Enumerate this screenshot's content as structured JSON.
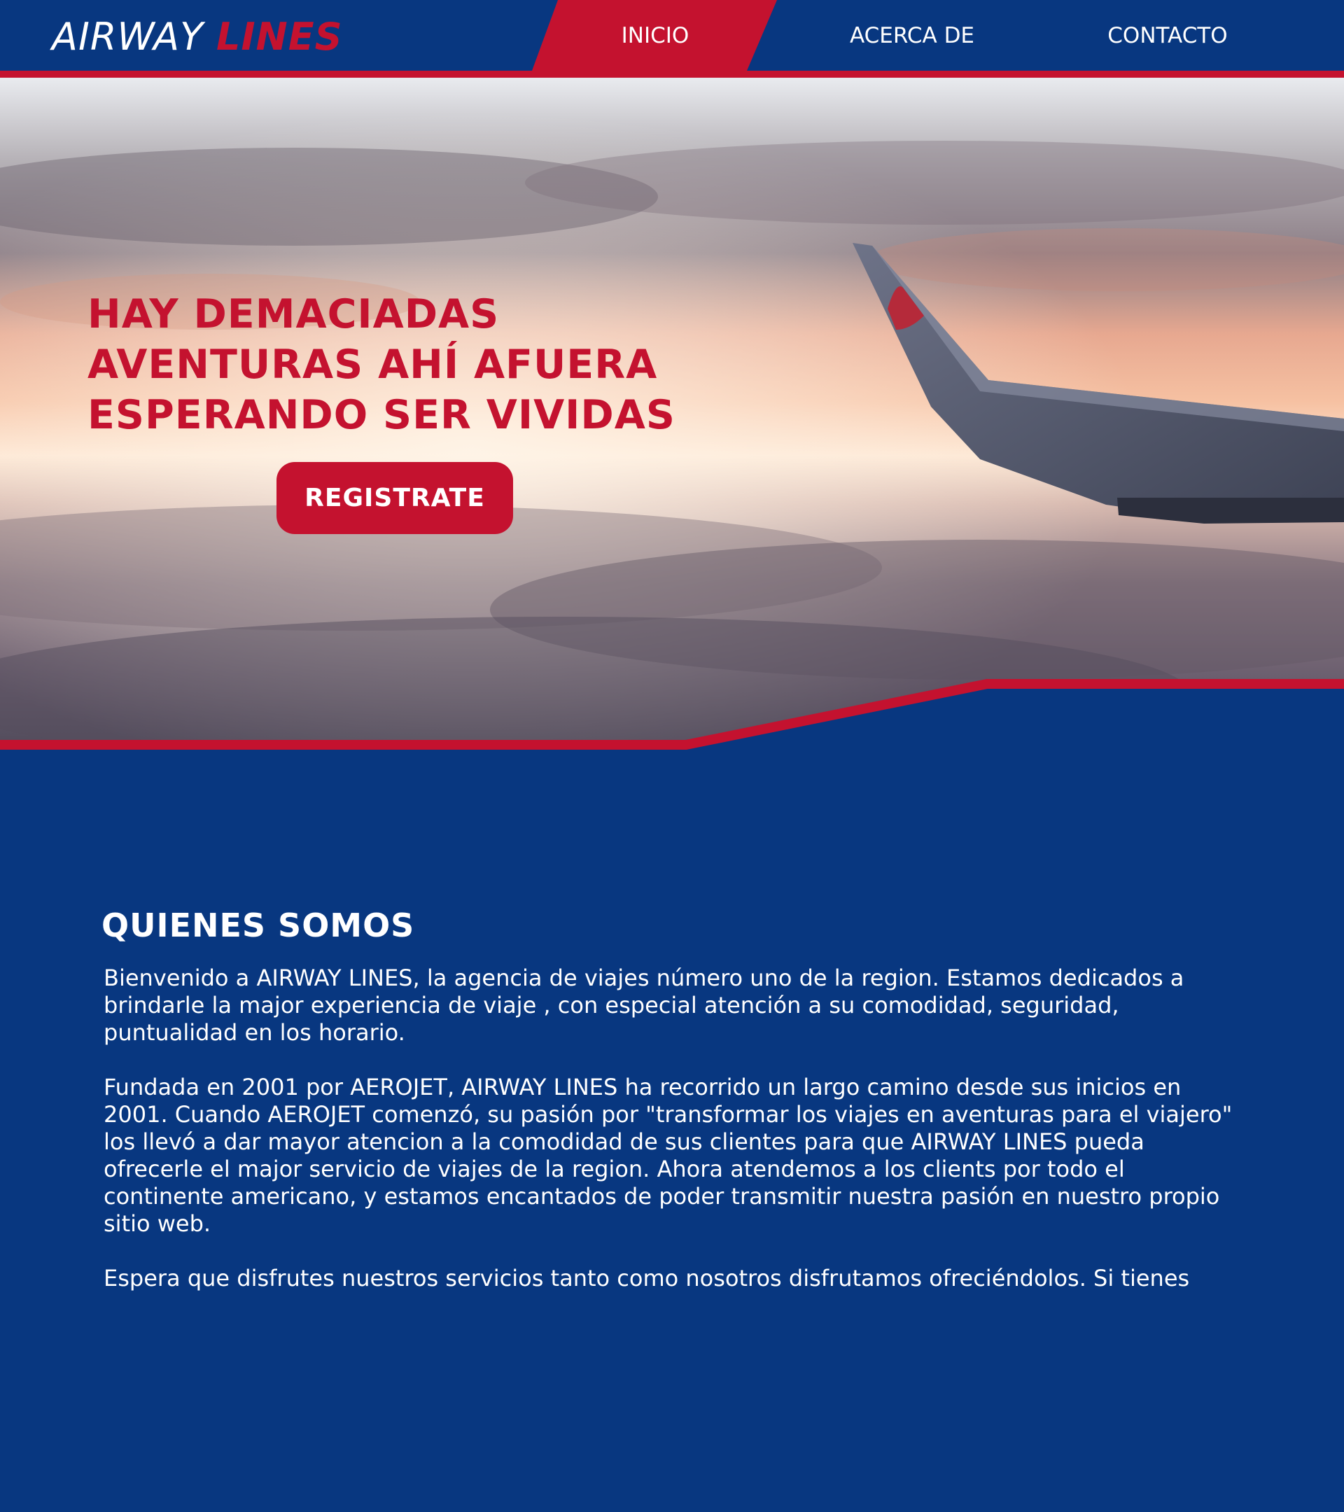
{
  "header": {
    "logo_word1": "AIRWAY",
    "logo_word2": "LINES",
    "nav": [
      {
        "label": "INICIO",
        "active": true
      },
      {
        "label": "ACERCA DE",
        "active": false
      },
      {
        "label": "CONTACTO",
        "active": false
      }
    ]
  },
  "hero": {
    "title_lines": [
      "HAY DEMACIADAS",
      "AVENTURAS AHÍ AFUERA",
      "ESPERANDO SER VIVIDAS"
    ],
    "cta_label": "REGISTRATE"
  },
  "about": {
    "heading": "QUIENES SOMOS",
    "paragraphs": [
      "Bienvenido a AIRWAY LINES, la agencia de viajes número uno de la region. Estamos dedicados a brindarle la major experiencia de viaje , con especial atención a su comodidad, seguridad, puntualidad en los horario.",
      "Fundada en 2001 por AEROJET, AIRWAY LINES ha recorrido un largo camino desde sus inicios en 2001. Cuando AEROJET comenzó, su pasión por \"transformar los viajes en aventuras para el viajero\" los llevó a dar mayor atencion a la comodidad de sus clientes para que AIRWAY LINES pueda ofrecerle el major servicio de viajes de la region. Ahora atendemos a los clients por todo el continente americano, y estamos encantados de poder transmitir nuestra pasión en  nuestro propio sitio web.",
      "Espera que disfrutes nuestros servicios tanto como nosotros disfrutamos ofreciéndolos. Si tienes"
    ]
  },
  "colors": {
    "navy": "#083780",
    "red": "#c4122f",
    "white": "#ffffff"
  },
  "icons": {
    "hero_image": "airplane-wing-above-clouds-sunset"
  }
}
